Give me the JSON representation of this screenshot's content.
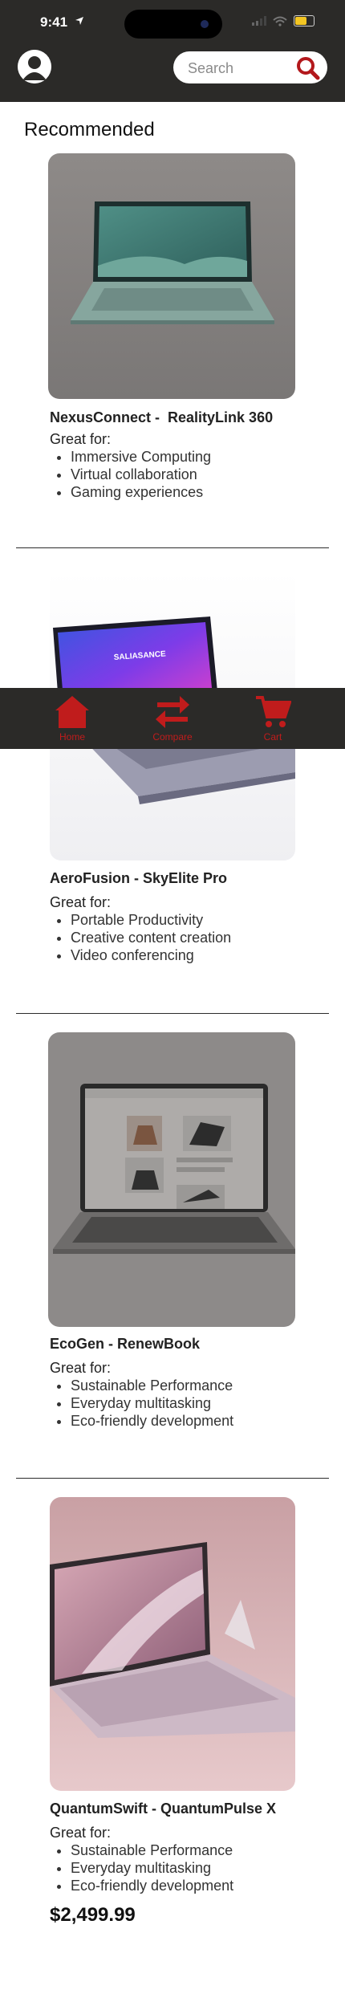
{
  "status_bar": {
    "time": "9:41"
  },
  "header": {
    "search": {
      "placeholder": "Search"
    }
  },
  "section_title": "Recommended",
  "products": [
    {
      "name": "NexusConnect -  RealityLink 360",
      "great_for_label": "Great for:",
      "features": [
        "Immersive Computing",
        "Virtual collaboration",
        "Gaming experiences"
      ]
    },
    {
      "name": "AeroFusion - SkyElite Pro",
      "screen_text": "SALIASANCE",
      "great_for_label": "Great for:",
      "features": [
        "Portable Productivity",
        "Creative content creation",
        "Video conferencing"
      ]
    },
    {
      "name": "EcoGen - RenewBook",
      "great_for_label": "Great for:",
      "features": [
        "Sustainable Performance",
        "Everyday multitasking",
        "Eco-friendly development"
      ]
    },
    {
      "name": "QuantumSwift - QuantumPulse X",
      "great_for_label": "Great for:",
      "features": [
        "Sustainable Performance",
        "Everyday multitasking",
        "Eco-friendly development"
      ],
      "price": "$2,499.99"
    }
  ],
  "tab_bar": {
    "tabs": [
      {
        "label": "Home",
        "icon": "home-icon"
      },
      {
        "label": "Compare",
        "icon": "compare-arrows-icon"
      },
      {
        "label": "Cart",
        "icon": "cart-icon"
      }
    ]
  },
  "colors": {
    "header_bg": "#2b2a28",
    "accent": "#c01c1c"
  }
}
